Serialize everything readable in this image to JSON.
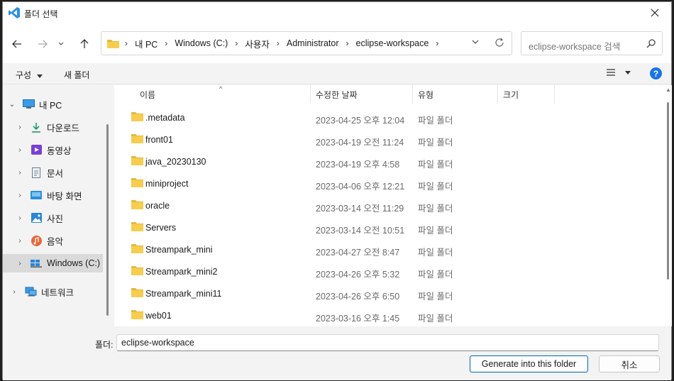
{
  "window": {
    "title": "폴더 선택",
    "accent": "#0078d4"
  },
  "address": {
    "crumbs": [
      "내 PC",
      "Windows (C:)",
      "사용자",
      "Administrator",
      "eclipse-workspace"
    ]
  },
  "search": {
    "placeholder": "eclipse-workspace 검색"
  },
  "toolbar": {
    "organize": "구성",
    "new_folder": "새 폴더"
  },
  "nav": {
    "items": [
      {
        "label": "내 PC",
        "icon": "pc-icon"
      },
      {
        "label": "다운로드",
        "icon": "download-icon"
      },
      {
        "label": "동영상",
        "icon": "video-icon"
      },
      {
        "label": "문서",
        "icon": "document-icon"
      },
      {
        "label": "바탕 화면",
        "icon": "desktop-icon"
      },
      {
        "label": "사진",
        "icon": "pictures-icon"
      },
      {
        "label": "음악",
        "icon": "music-icon"
      },
      {
        "label": "Windows (C:)",
        "icon": "drive-icon"
      },
      {
        "label": "네트워크",
        "icon": "network-icon"
      }
    ]
  },
  "columns": {
    "name": "이름",
    "modified": "수정한 날짜",
    "type": "유형",
    "size": "크기"
  },
  "files": [
    {
      "name": ".metadata",
      "date": "2023-04-25 오후 12:04",
      "type": "파일 폴더"
    },
    {
      "name": "front01",
      "date": "2023-04-19 오전 11:24",
      "type": "파일 폴더"
    },
    {
      "name": "java_20230130",
      "date": "2023-04-19 오후 4:58",
      "type": "파일 폴더"
    },
    {
      "name": "miniproject",
      "date": "2023-04-06 오후 12:21",
      "type": "파일 폴더"
    },
    {
      "name": "oracle",
      "date": "2023-03-14 오전 11:29",
      "type": "파일 폴더"
    },
    {
      "name": "Servers",
      "date": "2023-03-14 오전 10:51",
      "type": "파일 폴더"
    },
    {
      "name": "Streampark_mini",
      "date": "2023-04-27 오전 8:47",
      "type": "파일 폴더"
    },
    {
      "name": "Streampark_mini2",
      "date": "2023-04-26 오후 5:32",
      "type": "파일 폴더"
    },
    {
      "name": "Streampark_mini11",
      "date": "2023-04-26 오후 6:50",
      "type": "파일 폴더"
    },
    {
      "name": "web01",
      "date": "2023-03-16 오후 1:45",
      "type": "파일 폴더"
    }
  ],
  "footer": {
    "folder_label": "폴더:",
    "folder_value": "eclipse-workspace",
    "confirm_label": "Generate into this folder",
    "cancel_label": "취소"
  }
}
